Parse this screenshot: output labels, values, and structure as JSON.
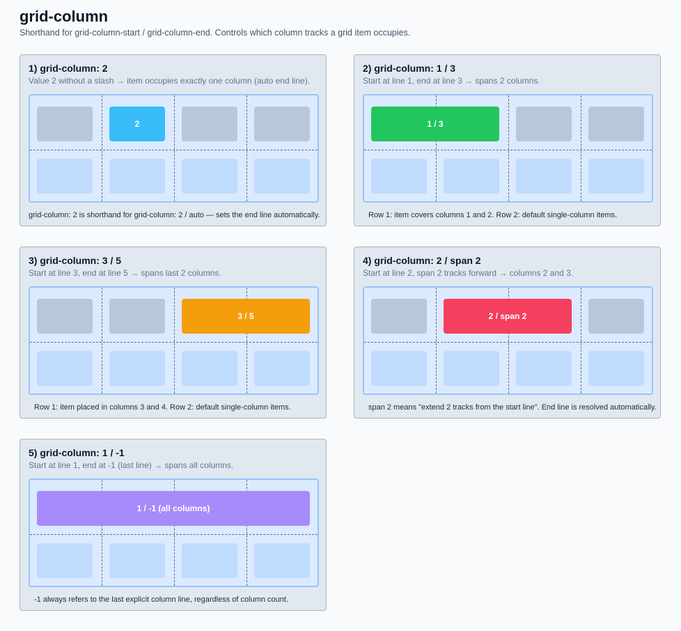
{
  "page": {
    "title": "grid-column",
    "subtitle": "Shorthand for grid-column-start / grid-column-end. Controls which column tracks a grid item occupies."
  },
  "colors": {
    "card_bg": "#e2e8f0",
    "grid_bg": "#dbeafe",
    "grid_border": "#93c5fd",
    "cell_muted": "#b8c7dc",
    "cell_light": "#bfdbfe",
    "item_blue": "#38bdf8",
    "item_green": "#22c55e",
    "item_orange": "#f59e0b",
    "item_red": "#f43f5e",
    "item_purple": "#a78bfa"
  },
  "examples": [
    {
      "title": "1) grid-column: 2",
      "description": "Value 2 without a slash → item occupies exactly one column (auto end line).",
      "item_label": "2",
      "note": "grid-column: 2 is shorthand for grid-column: 2 / auto — sets the end line automatically."
    },
    {
      "title": "2) grid-column: 1 / 3",
      "description": "Start at line 1, end at line 3 → spans 2 columns.",
      "item_label": "1 / 3",
      "note": "Row 1: item covers columns 1 and 2. Row 2: default single-column items."
    },
    {
      "title": "3) grid-column: 3 / 5",
      "description": "Start at line 3, end at line 5 → spans last 2 columns.",
      "item_label": "3 / 5",
      "note": "Row 1: item placed in columns 3 and 4. Row 2: default single-column items."
    },
    {
      "title": "4) grid-column: 2 / span 2",
      "description": "Start at line 2, span 2 tracks forward → columns 2 and 3.",
      "item_label": "2 / span 2",
      "note": "span 2 means \"extend 2 tracks from the start line\". End line is resolved automatically."
    },
    {
      "title": "5) grid-column: 1 / -1",
      "description": "Start at line 1, end at -1 (last line) → spans all columns.",
      "item_label": "1 / -1 (all columns)",
      "note": "-1 always refers to the last explicit column line, regardless of column count."
    }
  ]
}
